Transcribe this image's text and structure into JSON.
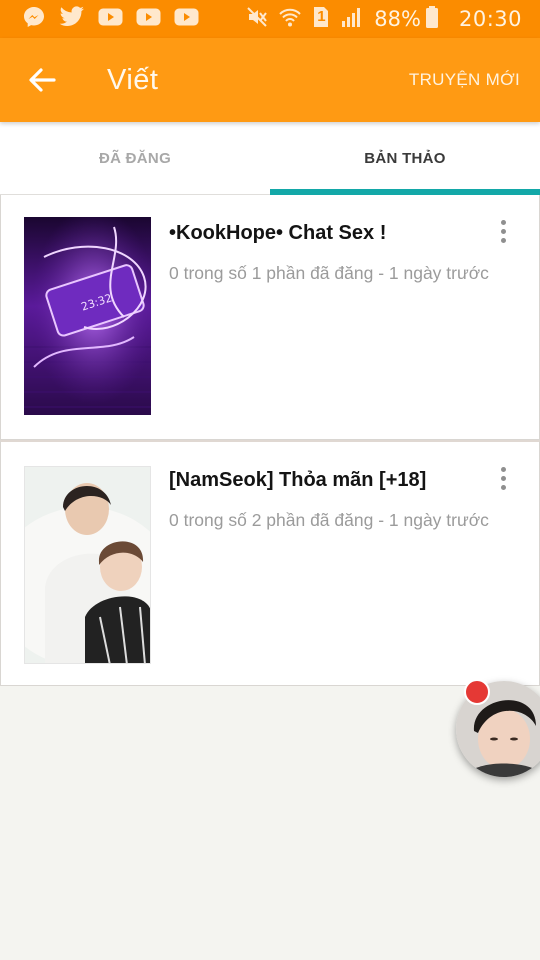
{
  "status_bar": {
    "battery_percent": "88%",
    "time": "20:30",
    "sim_slot": "1",
    "notification_icons": [
      "messenger-icon",
      "twitter-icon",
      "youtube-icon",
      "youtube-icon",
      "youtube-icon"
    ],
    "system_icons": [
      "mute-icon",
      "wifi-icon",
      "sim-icon",
      "signal-icon",
      "battery-icon"
    ]
  },
  "app_bar": {
    "back_icon": "arrow-left-icon",
    "title": "Viết",
    "new_story_label": "TRUYỆN MỚI",
    "background_color": "#ff9a13"
  },
  "tabs": [
    {
      "label": "ĐÃ ĐĂNG",
      "selected": false
    },
    {
      "label": "BẢN THẢO",
      "selected": true
    }
  ],
  "accent_color": "#13a8a8",
  "stories": [
    {
      "title": "•KookHope• Chat Sex !",
      "meta": "0 trong số 1 phần đã đăng - 1 ngày trước",
      "cover": "purple-neon-phone-cover"
    },
    {
      "title": "[NamSeok] Thỏa mãn [+18]",
      "meta": "0 trong số 2 phần đã đăng - 1 ngày trước",
      "cover": "two-people-photo-cover"
    }
  ],
  "chat_head": {
    "has_notification": true
  }
}
